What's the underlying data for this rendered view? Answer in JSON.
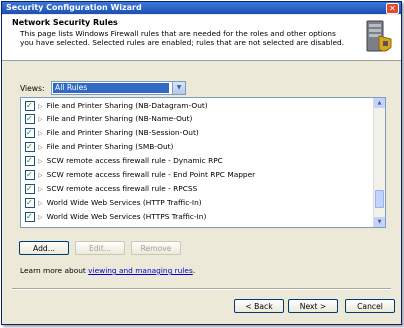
{
  "window": {
    "title": "Security Configuration Wizard",
    "close_glyph": "✕"
  },
  "header": {
    "title": "Network Security Rules",
    "description": "This page lists Windows Firewall rules that are needed for the roles and other options you have selected. Selected rules are enabled; rules that are not selected are disabled.",
    "icon": "security-server-icon"
  },
  "filter": {
    "label": "Views:",
    "selected": "All Rules"
  },
  "rules": [
    {
      "label": "File and Printer Sharing (NB-Datagram-Out)",
      "checked": true
    },
    {
      "label": "File and Printer Sharing (NB-Name-Out)",
      "checked": true
    },
    {
      "label": "File and Printer Sharing (NB-Session-Out)",
      "checked": true
    },
    {
      "label": "File and Printer Sharing (SMB-Out)",
      "checked": true
    },
    {
      "label": "SCW remote access firewall rule - Dynamic RPC",
      "checked": true
    },
    {
      "label": "SCW remote access firewall rule - End Point RPC Mapper",
      "checked": true
    },
    {
      "label": "SCW remote access firewall rule - RPCSS",
      "checked": true
    },
    {
      "label": "World Wide Web Services (HTTP Traffic-In)",
      "checked": true
    },
    {
      "label": "World Wide Web Services (HTTPS Traffic-In)",
      "checked": true
    }
  ],
  "rule_buttons": {
    "add": "Add...",
    "edit": "Edit...",
    "remove": "Remove"
  },
  "learn_more": {
    "prefix": "Learn more about ",
    "link": "viewing and managing rules",
    "suffix": "."
  },
  "nav": {
    "back": "< Back",
    "next": "Next >",
    "cancel": "Cancel"
  }
}
